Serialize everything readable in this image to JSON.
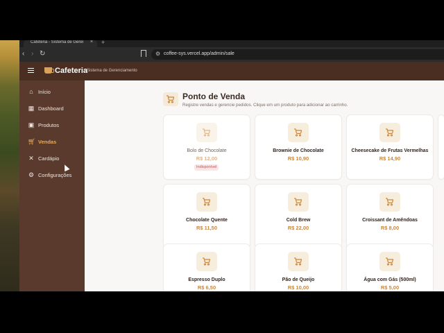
{
  "browser": {
    "tab_title": "Cafeteria - Sistema de Gerenciam",
    "url": "coffee-sys.vercel.app/admin/sale"
  },
  "app": {
    "brand": "Cafeteria",
    "brand_subtitle": "Sistema de Gerenciamento",
    "accent_color": "#e7a95c",
    "header_color": "#4a2e22",
    "sidebar_color": "#5a3a2c"
  },
  "sidebar": {
    "items": [
      {
        "label": "Início",
        "icon": "home-icon"
      },
      {
        "label": "Dashboard",
        "icon": "dashboard-icon"
      },
      {
        "label": "Produtos",
        "icon": "box-icon"
      },
      {
        "label": "Vendas",
        "icon": "cart-icon",
        "active": true
      },
      {
        "label": "Cardápio",
        "icon": "utensils-icon"
      },
      {
        "label": "Configurações",
        "icon": "gear-icon"
      }
    ]
  },
  "page": {
    "title": "Ponto de Venda",
    "subtitle": "Registre vendas e gerencie pedidos. Clique em um produto para adicionar ao carrinho."
  },
  "products": [
    {
      "name": "Bolo de Chocolate",
      "price": "R$ 12,00",
      "badge": "Indisponível",
      "available": false
    },
    {
      "name": "Brownie de Chocolate",
      "price": "R$ 10,90",
      "available": true
    },
    {
      "name": "Cheesecake de Frutas Vermelhas",
      "price": "R$ 14,90",
      "available": true
    },
    {
      "name": "Chocolate Quente",
      "price": "R$ 11,50",
      "available": true
    },
    {
      "name": "Cold Brew",
      "price": "R$ 22,00",
      "available": true
    },
    {
      "name": "Croissant de Amêndoas",
      "price": "R$ 8,00",
      "available": true
    },
    {
      "name": "Espresso Duplo",
      "price": "R$ 6,50",
      "available": true
    },
    {
      "name": "Pão de Queijo",
      "price": "R$ 10,00",
      "available": true
    },
    {
      "name": "Água com Gás (500ml)",
      "price": "R$ 5,00",
      "available": true
    }
  ]
}
